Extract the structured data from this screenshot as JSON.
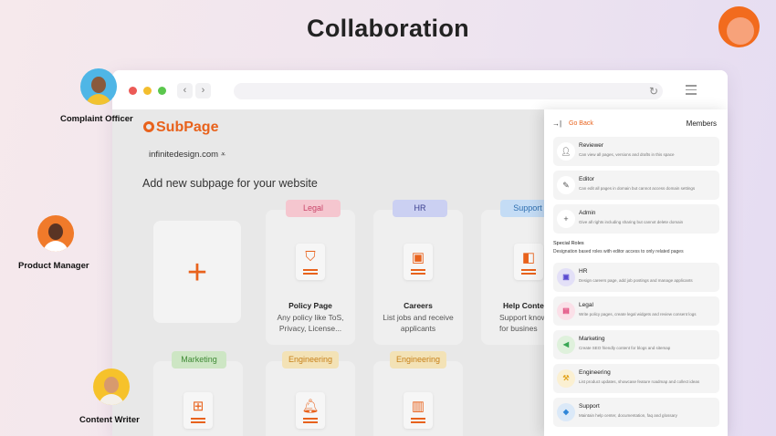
{
  "hero": {
    "title": "Collaboration"
  },
  "colors": {
    "accent": "#e8621c",
    "brand_circle": "#f26b1d"
  },
  "browser": {
    "nav_back_icon": "chevron-left-icon",
    "nav_forward_icon": "chevron-right-icon",
    "reload_icon": "reload-icon",
    "menu_icon": "hamburger-icon"
  },
  "app": {
    "logo": "SubPage",
    "workspace": "infinitedesign.com",
    "heading": "Add new subpage for your website",
    "templates": [
      {
        "tag": "Legal",
        "title": "Policy Page",
        "desc1": "Any policy like ToS,",
        "desc2": "Privacy, License...",
        "icon": "shield-icon"
      },
      {
        "tag": "HR",
        "title": "Careers",
        "desc1": "List jobs and receive",
        "desc2": "applicants",
        "icon": "id-badge-icon"
      },
      {
        "tag": "Support",
        "title": "Help Conte",
        "desc1": "Support knowledg",
        "desc2": "for busines",
        "icon": "help-doc-icon"
      },
      {
        "tag": "Marketing",
        "icon": "sitemap-icon"
      },
      {
        "tag": "Engineering",
        "icon": "bell-icon"
      },
      {
        "tag": "Engineering",
        "icon": "board-icon"
      }
    ]
  },
  "members_panel": {
    "go_back": "Go Back",
    "title": "Members",
    "roles": [
      {
        "name": "Reviewer",
        "desc": "Can view all pages, versions and drafts in this space",
        "icon": "user-icon"
      },
      {
        "name": "Editor",
        "desc": "Can edit all pages in domain but cannot access domain settings",
        "icon": "user-edit-icon"
      },
      {
        "name": "Admin",
        "desc": "Give all rights including sharing but cannot delete domain",
        "icon": "user-plus-icon"
      }
    ],
    "special_title": "Special Roles",
    "special_subtitle": "Designation based roles with editor access to only related pages",
    "special_roles": [
      {
        "name": "HR",
        "desc": "Design careers page, add job postings and manage applicants",
        "color": "#5b4bd1"
      },
      {
        "name": "Legal",
        "desc": "Write policy pages, create legal widgets and review consent logs",
        "color": "#e0457a"
      },
      {
        "name": "Marketing",
        "desc": "Create SEO friendly content for blogs and sitemap",
        "color": "#3aa655"
      },
      {
        "name": "Engineering",
        "desc": "List product updates, showcase feature roadmap and collect ideas",
        "color": "#e2a21b"
      },
      {
        "name": "Support",
        "desc": "Maintain help center, documentation, faq and glossary",
        "color": "#2f86d8"
      }
    ]
  },
  "personas": [
    {
      "label": "Complaint Officer"
    },
    {
      "label": "Product Manager"
    },
    {
      "label": "Content Writer"
    }
  ]
}
